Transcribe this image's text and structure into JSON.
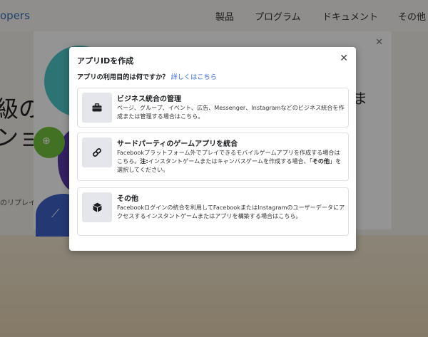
{
  "background": {
    "logo": "opers",
    "nav_items": [
      "製品",
      "プログラム",
      "ドキュメント",
      "その他"
    ],
    "headline_1": "級の",
    "headline_2": "ンョ",
    "subtext": "のリプレイ",
    "modal_glyph": "ま"
  },
  "dialog": {
    "title": "アプリIDを作成",
    "close_symbol": "✕",
    "question": "アプリの利用目的は何ですか？",
    "learn_more": "詳しくはこちら",
    "options": [
      {
        "title": "ビジネス統合の管理",
        "icon": "briefcase-icon",
        "description": "ページ、グループ、イベント、広告、Messenger、Instagramなどのビジネス統合を作成または管理する場合はこちら。"
      },
      {
        "title": "サードパーティのゲームアプリを統合",
        "icon": "link-icon",
        "description_part1": "Facebookプラットフォーム外でプレイできるモバイルゲームアプリを作成する場合はこちら。",
        "note_label": "注:",
        "description_part2": "インスタントゲームまたはキャンバスゲームを作成する場合、「",
        "emphasis": "その他",
        "description_part3": "」を選択してください。"
      },
      {
        "title": "その他",
        "icon": "cube-icon",
        "description": "Facebookログインの統合を利用してFacebookまたはInstagramのユーザーデータにアクセスするインスタントゲームまたはアプリを構築する場合はこちら。"
      }
    ]
  }
}
